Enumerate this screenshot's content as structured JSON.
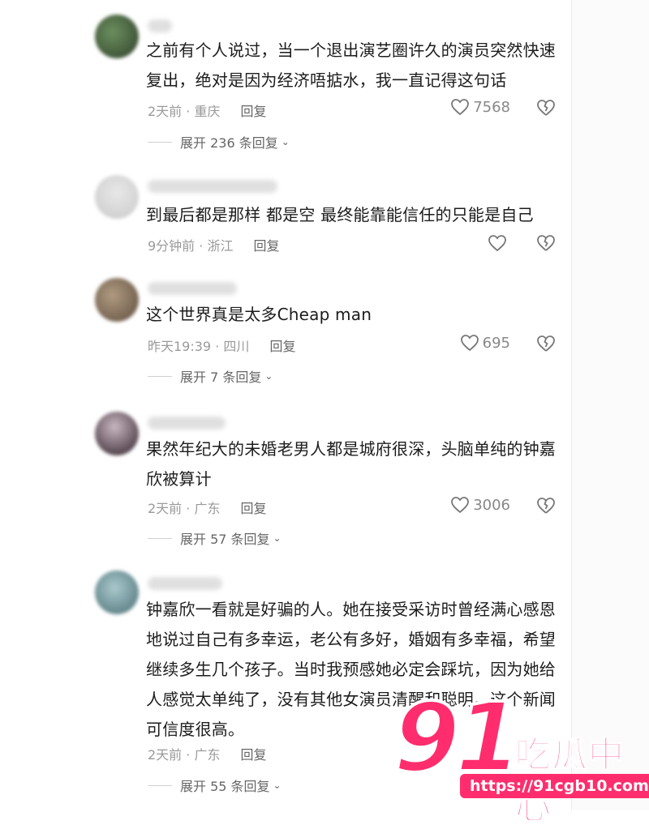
{
  "comments": [
    {
      "text": "之前有个人说过，当一个退出演艺圈许久的演员突然快速复出，绝对是因为经济唔掂水，我一直记得这句话",
      "time_location": "2天前 · 重庆",
      "reply_label": "回复",
      "likes": "7568",
      "expand_label": "展开 236 条回复",
      "avatar_color": "#3f5a3c"
    },
    {
      "text": "到最后都是那样 都是空 最终能靠能信任的只能是自己",
      "time_location": "9分钟前 · 浙江",
      "reply_label": "回复",
      "likes": "",
      "expand_label": "",
      "avatar_color": "#d6d6d6"
    },
    {
      "text": "这个世界真是太多Cheap man",
      "time_location": "昨天19:39 · 四川",
      "reply_label": "回复",
      "likes": "695",
      "expand_label": "展开 7 条回复",
      "avatar_color": "#8a7762"
    },
    {
      "text": "果然年纪大的未婚老男人都是城府很深，头脑单纯的钟嘉欣被算计",
      "time_location": "2天前 · 广东",
      "reply_label": "回复",
      "likes": "3006",
      "expand_label": "展开 57 条回复",
      "avatar_color": "#4a3642"
    },
    {
      "text": "钟嘉欣一看就是好骗的人。她在接受采访时曾经满心感恩地说过自己有多幸运，老公有多好，婚姻有多幸福，希望继续多生几个孩子。当时我预感她必定会踩坑，因为她给人感觉太单纯了，没有其他女演员清醒和聪明。这个新闻可信度很高。",
      "time_location": "2天前 · 广东",
      "reply_label": "回复",
      "likes": "",
      "expand_label": "展开 55 条回复",
      "avatar_color": "#7fa6a8"
    }
  ],
  "watermark": {
    "logo_number": "91",
    "logo_name": "吃瓜中心",
    "url": "https://91cgb10.com"
  },
  "icons": {
    "like": "heart-outline-icon",
    "dislike": "broken-heart-icon",
    "expand": "chevron-down-icon"
  }
}
